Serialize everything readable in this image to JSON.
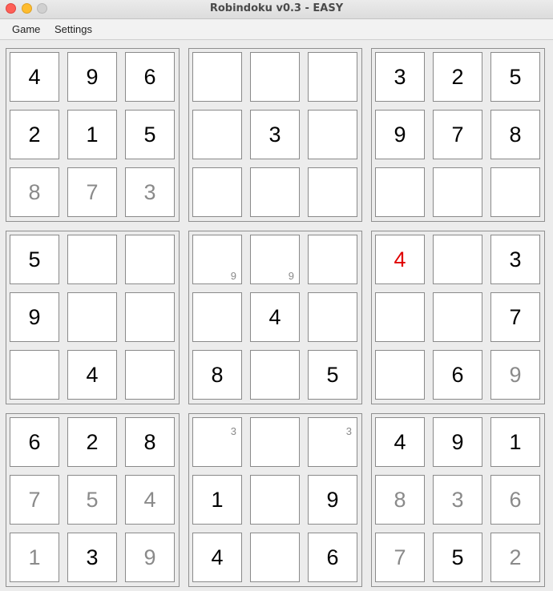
{
  "window": {
    "title": "Robindoku v0.3 - EASY"
  },
  "menu": {
    "game_label": "Game",
    "settings_label": "Settings"
  },
  "colors": {
    "given": "#000000",
    "entered": "#8a8a8a",
    "error": "#e00000",
    "note": "#8a8a8a"
  },
  "grid": [
    [
      {
        "v": "4",
        "s": "given"
      },
      {
        "v": "9",
        "s": "given"
      },
      {
        "v": "6",
        "s": "given"
      },
      {
        "v": "",
        "s": ""
      },
      {
        "v": "",
        "s": ""
      },
      {
        "v": "",
        "s": ""
      },
      {
        "v": "3",
        "s": "given"
      },
      {
        "v": "2",
        "s": "given"
      },
      {
        "v": "5",
        "s": "given"
      }
    ],
    [
      {
        "v": "2",
        "s": "given"
      },
      {
        "v": "1",
        "s": "given"
      },
      {
        "v": "5",
        "s": "given"
      },
      {
        "v": "",
        "s": ""
      },
      {
        "v": "3",
        "s": "given"
      },
      {
        "v": "",
        "s": ""
      },
      {
        "v": "9",
        "s": "given"
      },
      {
        "v": "7",
        "s": "given"
      },
      {
        "v": "8",
        "s": "given"
      }
    ],
    [
      {
        "v": "8",
        "s": "entered"
      },
      {
        "v": "7",
        "s": "entered"
      },
      {
        "v": "3",
        "s": "entered"
      },
      {
        "v": "",
        "s": ""
      },
      {
        "v": "",
        "s": ""
      },
      {
        "v": "",
        "s": ""
      },
      {
        "v": "",
        "s": ""
      },
      {
        "v": "",
        "s": ""
      },
      {
        "v": "",
        "s": ""
      }
    ],
    [
      {
        "v": "5",
        "s": "given"
      },
      {
        "v": "",
        "s": ""
      },
      {
        "v": "",
        "s": ""
      },
      {
        "v": "",
        "s": "",
        "note": "9",
        "np": "br"
      },
      {
        "v": "",
        "s": "",
        "note": "9",
        "np": "br"
      },
      {
        "v": "",
        "s": ""
      },
      {
        "v": "4",
        "s": "error"
      },
      {
        "v": "",
        "s": ""
      },
      {
        "v": "3",
        "s": "given"
      }
    ],
    [
      {
        "v": "9",
        "s": "given"
      },
      {
        "v": "",
        "s": ""
      },
      {
        "v": "",
        "s": ""
      },
      {
        "v": "",
        "s": ""
      },
      {
        "v": "4",
        "s": "given"
      },
      {
        "v": "",
        "s": ""
      },
      {
        "v": "",
        "s": ""
      },
      {
        "v": "",
        "s": ""
      },
      {
        "v": "7",
        "s": "given"
      }
    ],
    [
      {
        "v": "",
        "s": ""
      },
      {
        "v": "4",
        "s": "given"
      },
      {
        "v": "",
        "s": ""
      },
      {
        "v": "8",
        "s": "given"
      },
      {
        "v": "",
        "s": ""
      },
      {
        "v": "5",
        "s": "given"
      },
      {
        "v": "",
        "s": ""
      },
      {
        "v": "6",
        "s": "given"
      },
      {
        "v": "9",
        "s": "entered"
      }
    ],
    [
      {
        "v": "6",
        "s": "given"
      },
      {
        "v": "2",
        "s": "given"
      },
      {
        "v": "8",
        "s": "given"
      },
      {
        "v": "",
        "s": "",
        "note": "3",
        "np": "tr"
      },
      {
        "v": "",
        "s": ""
      },
      {
        "v": "",
        "s": "",
        "note": "3",
        "np": "tr"
      },
      {
        "v": "4",
        "s": "given"
      },
      {
        "v": "9",
        "s": "given"
      },
      {
        "v": "1",
        "s": "given"
      }
    ],
    [
      {
        "v": "7",
        "s": "entered"
      },
      {
        "v": "5",
        "s": "entered"
      },
      {
        "v": "4",
        "s": "entered"
      },
      {
        "v": "1",
        "s": "given"
      },
      {
        "v": "",
        "s": ""
      },
      {
        "v": "9",
        "s": "given"
      },
      {
        "v": "8",
        "s": "entered"
      },
      {
        "v": "3",
        "s": "entered"
      },
      {
        "v": "6",
        "s": "entered"
      }
    ],
    [
      {
        "v": "1",
        "s": "entered"
      },
      {
        "v": "3",
        "s": "given"
      },
      {
        "v": "9",
        "s": "entered"
      },
      {
        "v": "4",
        "s": "given"
      },
      {
        "v": "",
        "s": ""
      },
      {
        "v": "6",
        "s": "given"
      },
      {
        "v": "7",
        "s": "entered"
      },
      {
        "v": "5",
        "s": "given"
      },
      {
        "v": "2",
        "s": "entered"
      }
    ]
  ]
}
